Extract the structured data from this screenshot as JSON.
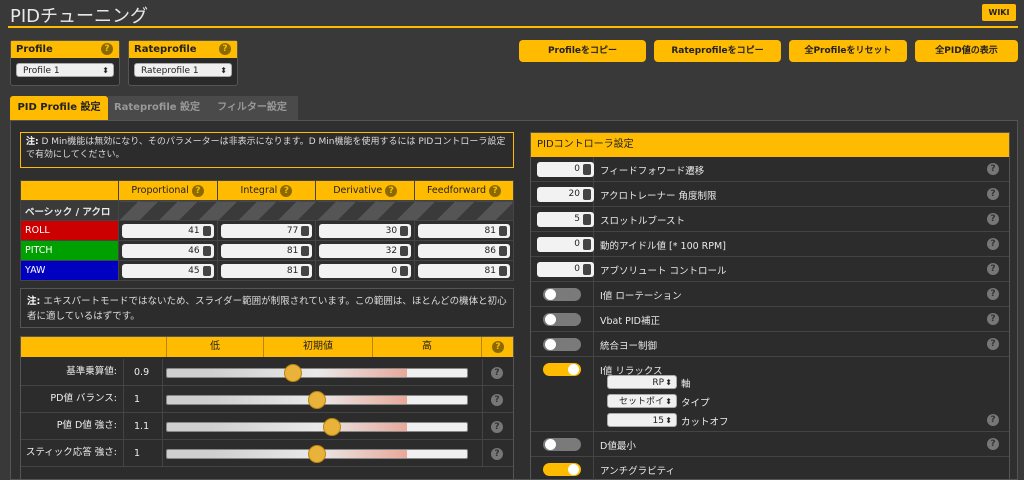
{
  "header": {
    "title": "PIDチューニング",
    "wiki": "WIKI"
  },
  "profile": {
    "label": "Profile",
    "selected": "Profile 1"
  },
  "rateprofile": {
    "label": "Rateprofile",
    "selected": "Rateprofile 1"
  },
  "actions": {
    "copy_profile": "Profileをコピー",
    "copy_rateprofile": "Rateprofileをコピー",
    "reset_profiles": "全Profileをリセット",
    "show_all_pid": "全PID値の表示"
  },
  "tabs": [
    "PID Profile 設定",
    "Rateprofile 設定",
    "フィルター設定"
  ],
  "note_dmin": {
    "prefix": "注:",
    "text": " D Min機能は無効になり、そのパラメーターは非表示になります。D Min機能を使用するには PIDコントローラ設定 で有効にしてください。"
  },
  "pid_table": {
    "headers": [
      "Proportional",
      "Integral",
      "Derivative",
      "Feedforward"
    ],
    "section": "ベーシック / アクロ",
    "rows": [
      {
        "axis": "ROLL",
        "color": "#cc0000",
        "values": [
          "41",
          "77",
          "30",
          "81"
        ]
      },
      {
        "axis": "PITCH",
        "color": "#00a000",
        "values": [
          "46",
          "81",
          "32",
          "86"
        ]
      },
      {
        "axis": "YAW",
        "color": "#0000c0",
        "values": [
          "45",
          "81",
          "0",
          "81"
        ]
      }
    ]
  },
  "note_expert": {
    "prefix": "注:",
    "text": " エキスパートモードではないため、スライダー範囲が制限されています。この範囲は、ほとんどの機体と初心者に適しているはずです。"
  },
  "sliders": {
    "headers": [
      "低",
      "初期値",
      "高"
    ],
    "rows": [
      {
        "label": "基準乗算値:",
        "value": "0.9",
        "level": 0.42
      },
      {
        "label": "PD値 バランス:",
        "value": "1",
        "level": 0.5
      },
      {
        "label": "P値 D値 強さ:",
        "value": "1.1",
        "level": 0.55
      },
      {
        "label": "スティック応答 強さ:",
        "value": "1",
        "level": 0.5
      }
    ]
  },
  "controller": {
    "title": "PIDコントローラ設定",
    "items": [
      {
        "type": "num",
        "value": "0",
        "label": "フィードフォワード遷移"
      },
      {
        "type": "num",
        "value": "20",
        "label": "アクロトレーナー 角度制限"
      },
      {
        "type": "num",
        "value": "5",
        "label": "スロットルブースト"
      },
      {
        "type": "num",
        "value": "0",
        "label": "動的アイドル値 [* 100 RPM]"
      },
      {
        "type": "num",
        "value": "0",
        "label": "アブソリュート コントロール"
      },
      {
        "type": "toggle",
        "on": false,
        "label": "I値 ローテーション"
      },
      {
        "type": "toggle",
        "on": false,
        "label": "Vbat PID補正"
      },
      {
        "type": "toggle",
        "on": false,
        "label": "統合ヨー制御"
      }
    ],
    "relax": {
      "label": "I値 リラックス",
      "axis_value": "RP",
      "axis_label": "軸",
      "type_value": "セットポイ",
      "type_label": "タイプ",
      "cutoff_value": "15",
      "cutoff_label": "カットオフ"
    },
    "dmin": {
      "label": "D値最小"
    },
    "antigravity": {
      "label": "アンチグラビティ"
    }
  }
}
